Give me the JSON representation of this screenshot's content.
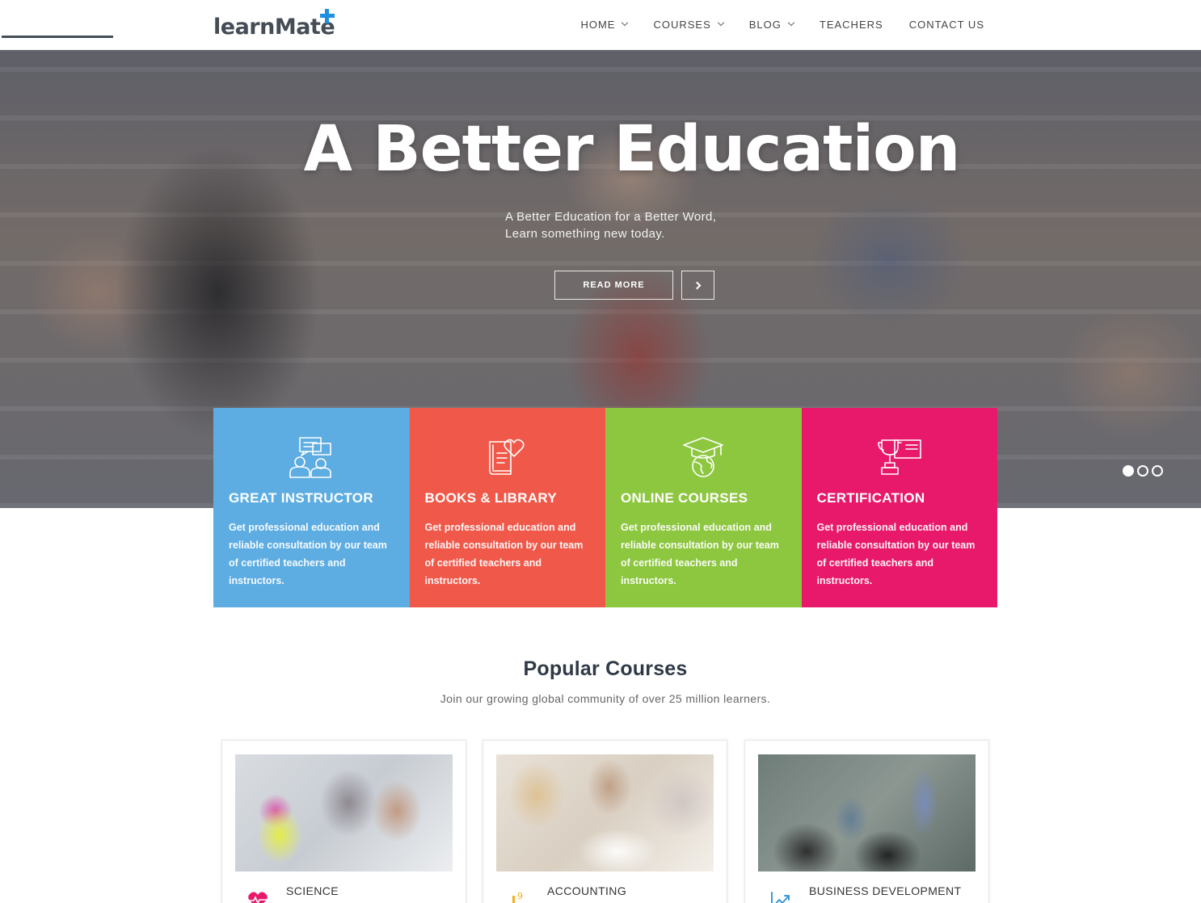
{
  "header": {
    "logo_text": "learnMate",
    "nav": [
      {
        "label": "HOME",
        "has_dropdown": true
      },
      {
        "label": "COURSES",
        "has_dropdown": true
      },
      {
        "label": "BLOG",
        "has_dropdown": true
      },
      {
        "label": "TEACHERS",
        "has_dropdown": false
      },
      {
        "label": "CONTACT US",
        "has_dropdown": false
      }
    ]
  },
  "hero": {
    "title": "A Better Education",
    "subtitle_line1": "A Better Education for a Better Word,",
    "subtitle_line2": "Learn something new today.",
    "read_more": "READ MORE",
    "slides": 3,
    "active_slide": 1
  },
  "features": [
    {
      "title": "GREAT INSTRUCTOR",
      "text": "Get professional education and reliable consultation by our team of certified teachers and instructors.",
      "color": "#5dade2",
      "icon": "instructor-icon"
    },
    {
      "title": "BOOKS & LIBRARY",
      "text": "Get professional education and reliable consultation by our team of certified teachers and instructors.",
      "color": "#f0594a",
      "icon": "book-heart-icon"
    },
    {
      "title": "ONLINE COURSES",
      "text": "Get professional education and reliable consultation by our team of certified teachers and instructors.",
      "color": "#8dc63f",
      "icon": "graduation-globe-icon"
    },
    {
      "title": "CERTIFICATION",
      "text": "Get professional education and reliable consultation by our team of certified teachers and instructors.",
      "color": "#e8196a",
      "icon": "trophy-certificate-icon"
    }
  ],
  "popular": {
    "title": "Popular Courses",
    "subtitle": "Join our growing global community of over 25 million learners.",
    "courses": [
      {
        "name": "SCIENCE",
        "icon": "heartbeat-icon",
        "icon_color": "#e8196a"
      },
      {
        "name": "ACCOUNTING",
        "icon": "numbers-icon",
        "icon_color": "#f2b01e"
      },
      {
        "name": "BUSINESS DEVELOPMENT",
        "icon": "chart-growth-icon",
        "icon_color": "#3a9ad9"
      }
    ]
  }
}
